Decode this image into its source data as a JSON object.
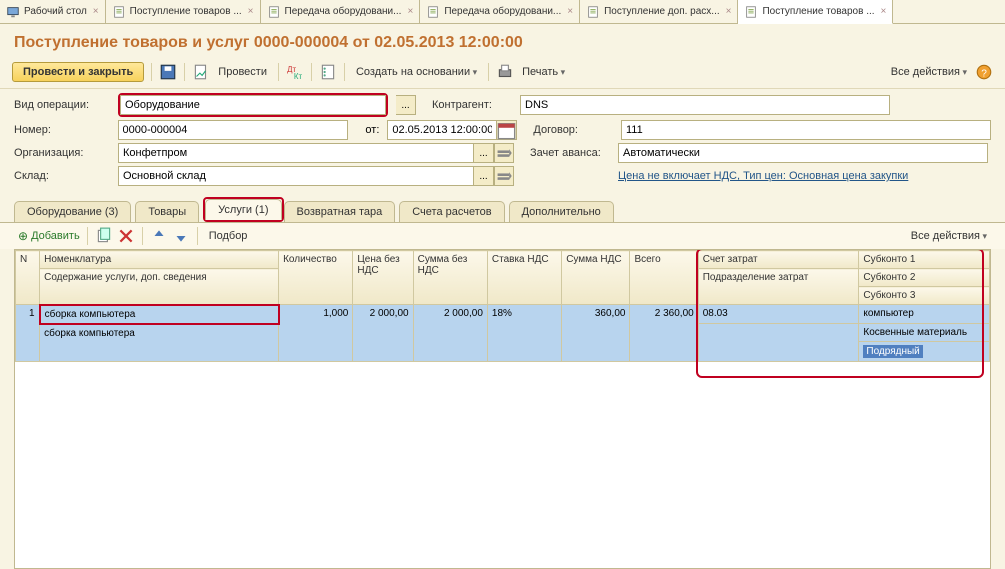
{
  "appTabs": [
    {
      "label": "Рабочий стол"
    },
    {
      "label": "Поступление товаров ..."
    },
    {
      "label": "Передача оборудовани..."
    },
    {
      "label": "Передача оборудовани..."
    },
    {
      "label": "Поступление доп. расх..."
    },
    {
      "label": "Поступление товаров ...",
      "active": true
    }
  ],
  "title": "Поступление товаров и услуг 0000-000004 от 02.05.2013 12:00:00",
  "cmd": {
    "post_close": "Провести и закрыть",
    "post": "Провести",
    "create_based": "Создать на основании",
    "print": "Печать",
    "all_actions": "Все действия"
  },
  "form": {
    "opType_lbl": "Вид операции:",
    "opType_val": "Оборудование",
    "num_lbl": "Номер:",
    "num_val": "0000-000004",
    "date_lbl": "от:",
    "date_val": "02.05.2013 12:00:00",
    "org_lbl": "Организация:",
    "org_val": "Конфетпром",
    "wh_lbl": "Склад:",
    "wh_val": "Основной склад",
    "cp_lbl": "Контрагент:",
    "cp_val": "DNS",
    "contract_lbl": "Договор:",
    "contract_val": "111",
    "advance_lbl": "Зачет аванса:",
    "advance_val": "Автоматически",
    "price_link": "Цена не включает НДС, Тип цен: Основная цена закупки"
  },
  "docTabs": [
    {
      "label": "Оборудование (3)"
    },
    {
      "label": "Товары"
    },
    {
      "label": "Услуги (1)",
      "active": true,
      "hl": true
    },
    {
      "label": "Возвратная тара"
    },
    {
      "label": "Счета расчетов"
    },
    {
      "label": "Дополнительно"
    }
  ],
  "tblTb": {
    "add": "Добавить",
    "podbor": "Подбор",
    "all_actions": "Все действия"
  },
  "tbl": {
    "headers": {
      "n": "N",
      "nomen": "Номенклатура",
      "content": "Содержание услуги, доп. сведения",
      "qty": "Количество",
      "price_novat": "Цена без НДС",
      "sum_novat": "Сумма без НДС",
      "vat_rate": "Ставка НДС",
      "vat_sum": "Сумма НДС",
      "total": "Всего",
      "cost_acc": "Счет затрат",
      "division": "Подразделение затрат",
      "sub1": "Субконто 1",
      "sub2": "Субконто 2",
      "sub3": "Субконто 3"
    },
    "rows": [
      {
        "n": "1",
        "nomen": "сборка компьютера",
        "content": "сборка компьютера",
        "qty": "1,000",
        "price_novat": "2 000,00",
        "sum_novat": "2 000,00",
        "vat_rate": "18%",
        "vat_sum": "360,00",
        "total": "2 360,00",
        "cost_acc": "08.03",
        "division": "",
        "sub1": "компьютер",
        "sub2": "Косвенные материаль",
        "sub3": "Подрядный"
      }
    ]
  }
}
